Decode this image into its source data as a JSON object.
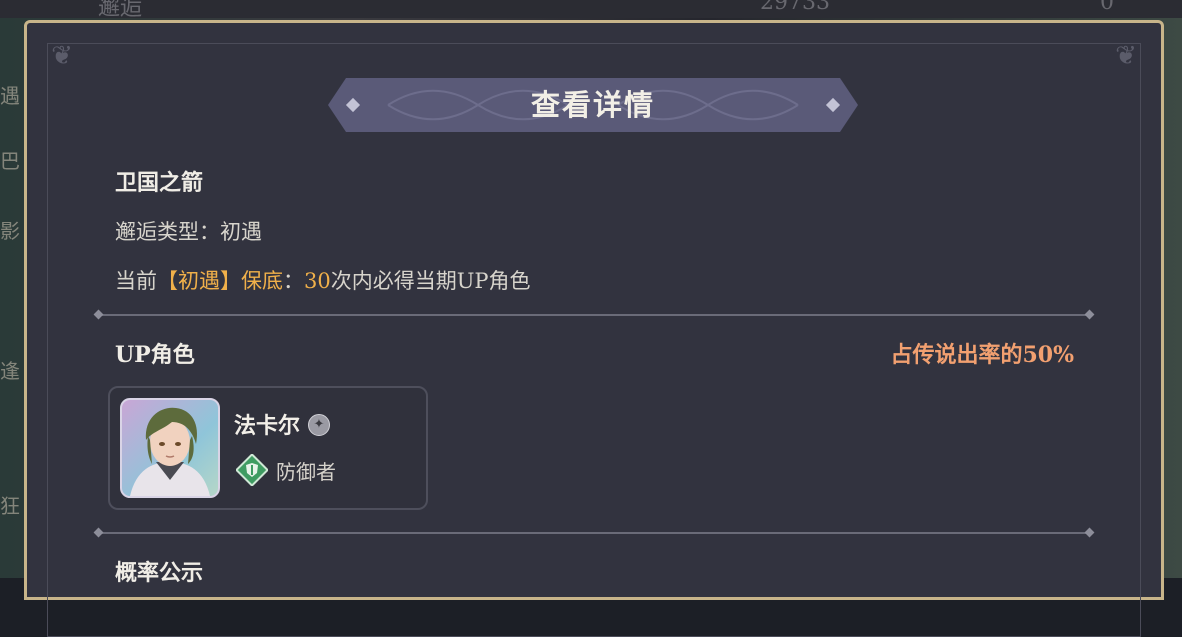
{
  "background": {
    "top_left_text": "邂逅",
    "top_mid_number": "29733",
    "top_right_number": "0",
    "side_chars": [
      "遇",
      "巴",
      "影",
      "逢",
      "狂"
    ]
  },
  "dialog": {
    "title": "查看详情",
    "pool_name": "卫国之箭",
    "encounter_type_label": "邂逅类型：",
    "encounter_type_value": "初遇",
    "pity_prefix": "当前",
    "pity_highlight": "【初遇】保底",
    "pity_colon": "：",
    "pity_count": "30",
    "pity_suffix": "次内必得当期UP角色",
    "up_section_title": "UP角色",
    "up_rate_text": "占传说出率的50%",
    "character": {
      "name": "法卡尔",
      "element_icon": "element-badge-icon",
      "role": "防御者",
      "role_icon": "defender-shield-icon"
    },
    "probability_section_title": "概率公示"
  },
  "colors": {
    "panel_bg": "#32333f",
    "panel_border": "#c8b58a",
    "banner_bg": "#5a5a78",
    "highlight": "#f0b04a",
    "rate": "#f2a070",
    "role_green": "#3f9c62"
  }
}
